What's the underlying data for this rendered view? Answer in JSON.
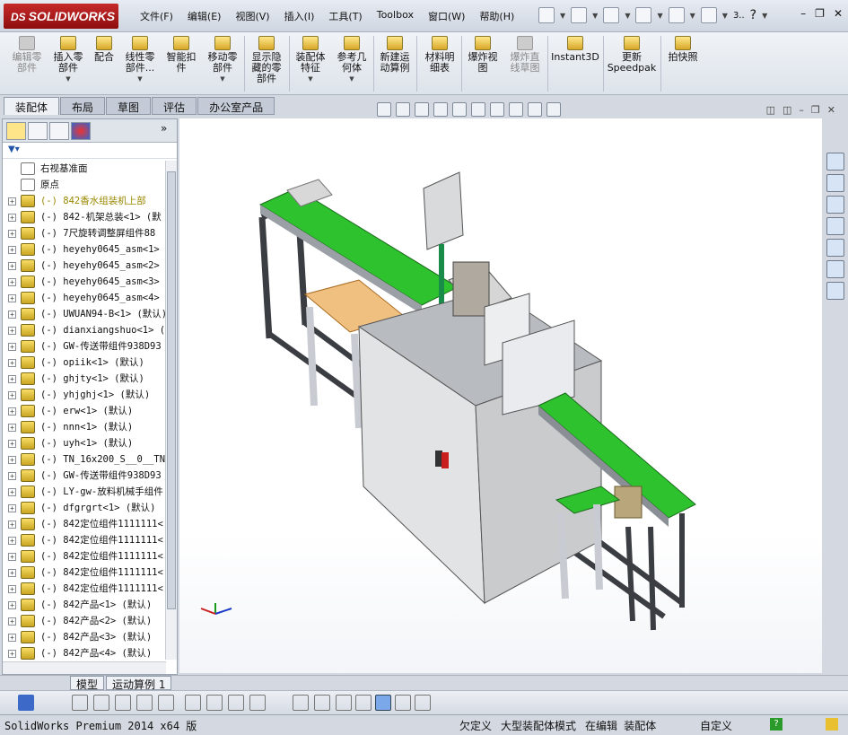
{
  "app": {
    "logo_prefix": "DS",
    "logo_text": "SOLIDWORKS",
    "version_text": "SolidWorks Premium 2014 x64 版"
  },
  "menu": [
    "文件(F)",
    "编辑(E)",
    "视图(V)",
    "插入(I)",
    "工具(T)",
    "Toolbox",
    "窗口(W)",
    "帮助(H)"
  ],
  "qat_extra": "3..",
  "ribbon": [
    {
      "label": "编辑零\n部件",
      "enabled": false
    },
    {
      "label": "插入零\n部件",
      "enabled": true
    },
    {
      "label": "配合",
      "enabled": true
    },
    {
      "label": "线性零\n部件...",
      "enabled": true
    },
    {
      "label": "智能扣\n件",
      "enabled": true
    },
    {
      "label": "移动零\n部件",
      "enabled": true
    },
    {
      "label": "显示隐\n藏的零\n部件",
      "enabled": true
    },
    {
      "label": "装配体\n特征",
      "enabled": true
    },
    {
      "label": "参考几\n何体",
      "enabled": true
    },
    {
      "label": "新建运\n动算例",
      "enabled": true
    },
    {
      "label": "材料明\n细表",
      "enabled": true
    },
    {
      "label": "爆炸视\n图",
      "enabled": true
    },
    {
      "label": "爆炸直\n线草图",
      "enabled": false
    },
    {
      "label": "Instant3D",
      "enabled": true
    },
    {
      "label": "更新\nSpeedpak",
      "enabled": true
    },
    {
      "label": "拍快照",
      "enabled": true
    }
  ],
  "tabs": [
    "装配体",
    "布局",
    "草图",
    "评估",
    "办公室产品"
  ],
  "tree": [
    {
      "label": "右视基准面",
      "type": "plane"
    },
    {
      "label": "原点",
      "type": "origin"
    },
    {
      "label": "(-) 842香水组装机上部",
      "type": "warn"
    },
    {
      "label": "(-) 842-机架总装<1> (默",
      "type": "asm"
    },
    {
      "label": "(-) 7尺旋转调整屏组件88",
      "type": "asm"
    },
    {
      "label": "(-) heyehy0645_asm<1> (",
      "type": "asm"
    },
    {
      "label": "(-) heyehy0645_asm<2> (",
      "type": "asm"
    },
    {
      "label": "(-) heyehy0645_asm<3> (",
      "type": "asm"
    },
    {
      "label": "(-) heyehy0645_asm<4> (",
      "type": "asm"
    },
    {
      "label": "(-) UWUAN94-B<1> (默认)",
      "type": "asm"
    },
    {
      "label": "(-) dianxiangshuo<1> (默",
      "type": "asm"
    },
    {
      "label": "(-) GW-传送带组件938D93",
      "type": "asm"
    },
    {
      "label": "(-) opiik<1> (默认)",
      "type": "asm"
    },
    {
      "label": "(-) ghjty<1> (默认)",
      "type": "asm"
    },
    {
      "label": "(-) yhjghj<1> (默认)",
      "type": "asm"
    },
    {
      "label": "(-) erw<1> (默认)",
      "type": "asm"
    },
    {
      "label": "(-) nnn<1> (默认)",
      "type": "asm"
    },
    {
      "label": "(-) uyh<1> (默认)",
      "type": "asm"
    },
    {
      "label": "(-) TN_16x200_S__0__TN-",
      "type": "asm"
    },
    {
      "label": "(-) GW-传送带组件938D93",
      "type": "asm"
    },
    {
      "label": "(-) LY-gw-放料机械手组件",
      "type": "asm"
    },
    {
      "label": "(-) dfgrgrt<1> (默认)",
      "type": "asm"
    },
    {
      "label": "(-) 842定位组件1111111<",
      "type": "asm"
    },
    {
      "label": "(-) 842定位组件1111111<",
      "type": "asm"
    },
    {
      "label": "(-) 842定位组件1111111<",
      "type": "asm"
    },
    {
      "label": "(-) 842定位组件1111111<",
      "type": "asm"
    },
    {
      "label": "(-) 842定位组件1111111<",
      "type": "asm"
    },
    {
      "label": "(-) 842产品<1> (默认)",
      "type": "asm"
    },
    {
      "label": "(-) 842产品<2> (默认)",
      "type": "asm"
    },
    {
      "label": "(-) 842产品<3> (默认)",
      "type": "asm"
    },
    {
      "label": "(-) 842产品<4> (默认)",
      "type": "asm"
    }
  ],
  "bottom_tabs": [
    "模型",
    "运动算例 1"
  ],
  "status": {
    "s1": "欠定义",
    "s2": "大型装配体模式",
    "s3": "在编辑 装配体",
    "s4": "自定义"
  },
  "colors": {
    "conveyor_green": "#2fc22f",
    "frame_gray": "#8a8f96",
    "body_light": "#e8e8e8",
    "accent_red": "#c81e1e"
  }
}
